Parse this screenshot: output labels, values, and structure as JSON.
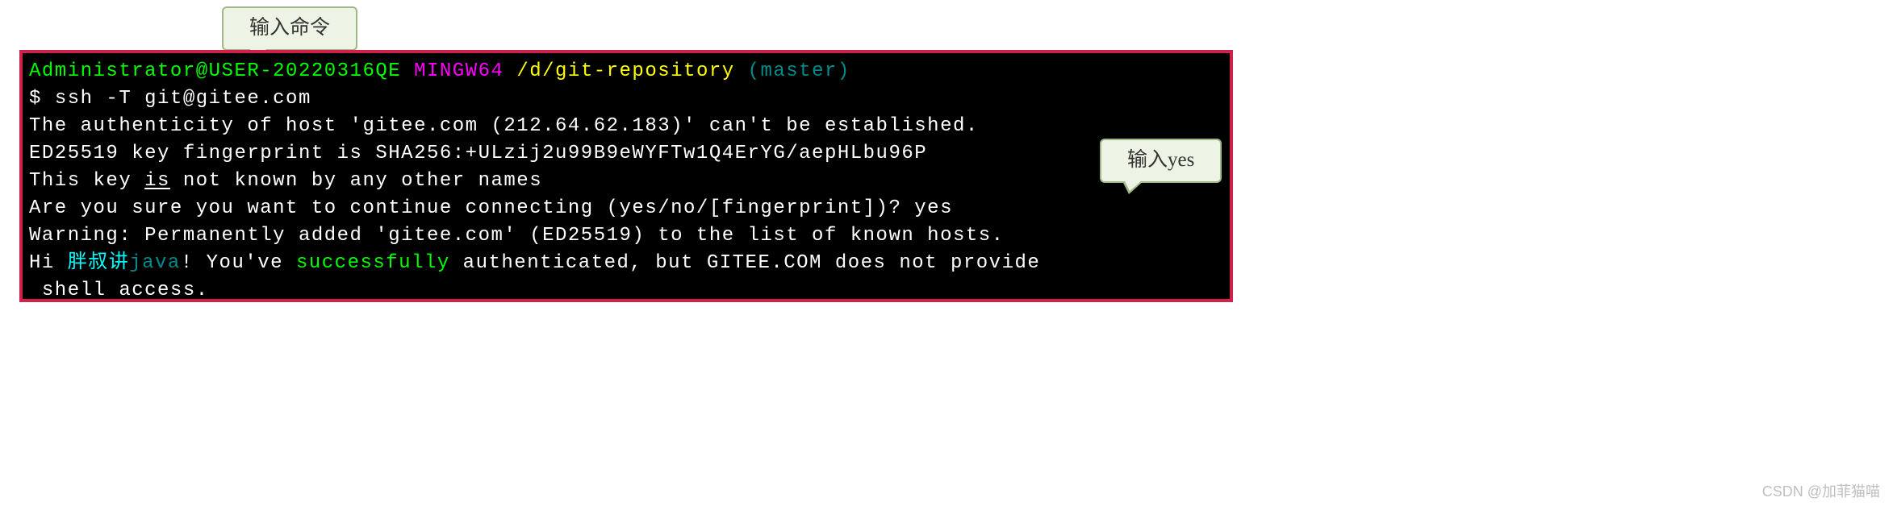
{
  "callouts": {
    "tip1": "输入命令",
    "tip2": "输入yes"
  },
  "terminal": {
    "prompt": {
      "user_host": "Administrator@USER-20220316QE",
      "env": "MINGW64",
      "path": "/d/git-repository",
      "branch": "(master)"
    },
    "prompt_symbol": "$ ",
    "command": "ssh -T git@gitee.com",
    "line_auth": "The authenticity of host 'gitee.com (212.64.62.183)' can't be established.",
    "line_fp": "ED25519 key fingerprint is SHA256:+ULzij2u99B9eWYFTw1Q4ErYG/aepHLbu96P",
    "line_known_pre": "This key ",
    "line_known_is": "is",
    "line_known_post": " not known by any other names",
    "line_confirm": "Are you sure you want to continue connecting (yes/no/[fingerprint])? yes",
    "line_warn": "Warning: Permanently added 'gitee.com' (ED25519) to the list of known hosts.",
    "hi_pre": "Hi ",
    "hi_name_cn": "胖叔讲",
    "hi_name_en": "java",
    "hi_mid1": "! You've ",
    "hi_success": "successfully",
    "hi_mid2": " authenticated, but GITEE.COM does not provide",
    "line_shell": " shell access."
  },
  "watermark": "CSDN @加菲猫喵"
}
